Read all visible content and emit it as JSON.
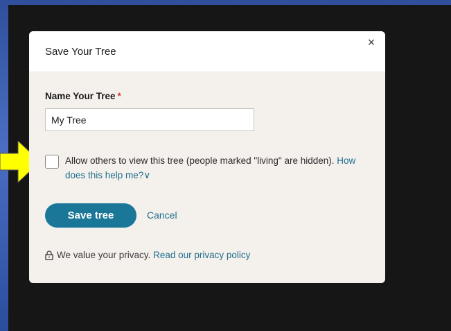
{
  "modal": {
    "title": "Save Your Tree",
    "close_icon": "×",
    "name_label": "Name Your Tree",
    "required_mark": "*",
    "name_value": "My Tree",
    "share_text": "Allow others to view this tree (people marked \"living\" are hidden).",
    "help_link": "How does this help me?",
    "chevron_icon": "∨",
    "save_label": "Save tree",
    "cancel_label": "Cancel",
    "privacy_text": "We value your privacy.",
    "privacy_link": "Read our privacy policy"
  },
  "colors": {
    "accent": "#1a7797",
    "link": "#1f6e8f",
    "required": "#d13b2f",
    "arrow_fill": "#ffff00"
  }
}
